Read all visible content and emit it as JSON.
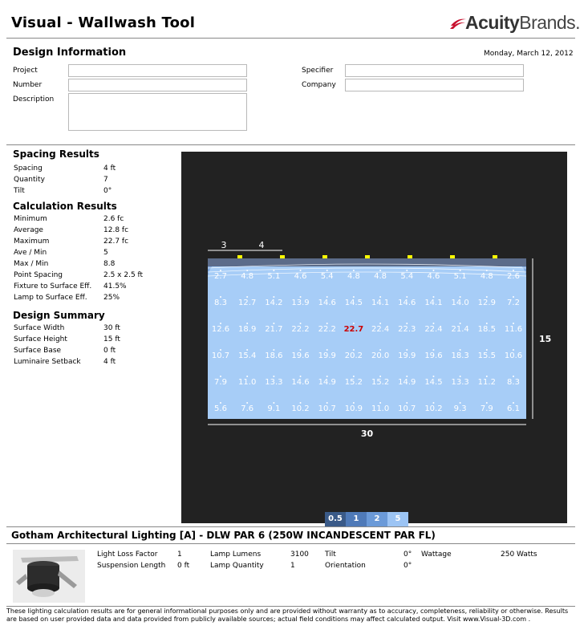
{
  "header": {
    "title": "Visual - Wallwash Tool",
    "brand_bold": "Acuity",
    "brand_rest": "Brands",
    "brand_mark": ".",
    "date": "Monday, March 12, 2012",
    "accent_color": "#c8102e"
  },
  "design_info": {
    "heading": "Design Information",
    "project_label": "Project",
    "project_value": "",
    "number_label": "Number",
    "number_value": "",
    "description_label": "Description",
    "description_value": "",
    "specifier_label": "Specifier",
    "specifier_value": "",
    "company_label": "Company",
    "company_value": ""
  },
  "spacing_results": {
    "heading": "Spacing Results",
    "rows": [
      {
        "label": "Spacing",
        "value": "4  ft"
      },
      {
        "label": "Quantity",
        "value": "7"
      },
      {
        "label": "Tilt",
        "value": "0°"
      }
    ]
  },
  "calculation_results": {
    "heading": "Calculation Results",
    "rows": [
      {
        "label": "Minimum",
        "value": "2.6  fc"
      },
      {
        "label": "Average",
        "value": "12.8  fc"
      },
      {
        "label": "Maximum",
        "value": "22.7  fc"
      },
      {
        "label": "Ave / Min",
        "value": "5"
      },
      {
        "label": "Max / Min",
        "value": "8.8"
      },
      {
        "label": "Point Spacing",
        "value": "2.5 x 2.5  ft"
      },
      {
        "label": "Fixture to Surface Eff.",
        "value": "41.5%"
      },
      {
        "label": "Lamp to Surface Eff.",
        "value": "25%"
      }
    ]
  },
  "design_summary": {
    "heading": "Design Summary",
    "rows": [
      {
        "label": "Surface Width",
        "value": "30  ft"
      },
      {
        "label": "Surface Height",
        "value": "15  ft"
      },
      {
        "label": "Surface Base",
        "value": "0  ft"
      },
      {
        "label": "Luminaire Setback",
        "value": "4  ft"
      }
    ]
  },
  "plot": {
    "offset_label": "3",
    "spacing_label": "4",
    "width_label": "30",
    "height_label": "15",
    "luminaire_count": 7,
    "max_value": "22.7",
    "grid": [
      [
        "2.7",
        "4.8",
        "5.1",
        "4.6",
        "5.4",
        "4.8",
        "4.8",
        "5.4",
        "4.6",
        "5.1",
        "4.8",
        "2.6"
      ],
      [
        "8.3",
        "12.7",
        "14.2",
        "13.9",
        "14.6",
        "14.5",
        "14.1",
        "14.6",
        "14.1",
        "14.0",
        "12.9",
        "7.2"
      ],
      [
        "12.6",
        "18.9",
        "21.7",
        "22.2",
        "22.2",
        "22.7",
        "22.4",
        "22.3",
        "22.4",
        "21.4",
        "18.5",
        "11.6"
      ],
      [
        "10.7",
        "15.4",
        "18.6",
        "19.6",
        "19.9",
        "20.2",
        "20.0",
        "19.9",
        "19.6",
        "18.3",
        "15.5",
        "10.6"
      ],
      [
        "7.9",
        "11.0",
        "13.3",
        "14.6",
        "14.9",
        "15.2",
        "15.2",
        "14.9",
        "14.5",
        "13.3",
        "11.2",
        "8.3"
      ],
      [
        "5.6",
        "7.6",
        "9.1",
        "10.2",
        "10.7",
        "10.9",
        "11.0",
        "10.7",
        "10.2",
        "9.3",
        "7.9",
        "6.1"
      ]
    ],
    "legend": [
      "0.5",
      "1",
      "2",
      "5"
    ],
    "legend_colors": [
      "#3a5a88",
      "#4f7ab8",
      "#6b9ad8",
      "#9cc4f4"
    ],
    "surface_color": "#a7cdf7",
    "luminaire_color": "#ffff00",
    "max_color": "#cc0000"
  },
  "luminaire": {
    "title": "Gotham Architectural Lighting   [A]  - DLW PAR 6 (250W INCANDESCENT PAR FL)",
    "specs": [
      {
        "label": "Light Loss Factor",
        "value": "1"
      },
      {
        "label": "Lamp Lumens",
        "value": "3100"
      },
      {
        "label": "Tilt",
        "value": "0°"
      },
      {
        "label": "Wattage",
        "value": "250  Watts"
      },
      {
        "label": "Suspension Length",
        "value": "0  ft"
      },
      {
        "label": "Lamp Quantity",
        "value": "1"
      },
      {
        "label": "Orientation",
        "value": "0°"
      }
    ]
  },
  "disclaimer": "These lighting calculation results are for general informational purposes only and are provided without warranty as to accuracy, completeness, reliability or otherwise. Results are based on user provided data and data provided from publicly available sources; actual field conditions may affect calculated output. Visit www.Visual-3D.com ."
}
